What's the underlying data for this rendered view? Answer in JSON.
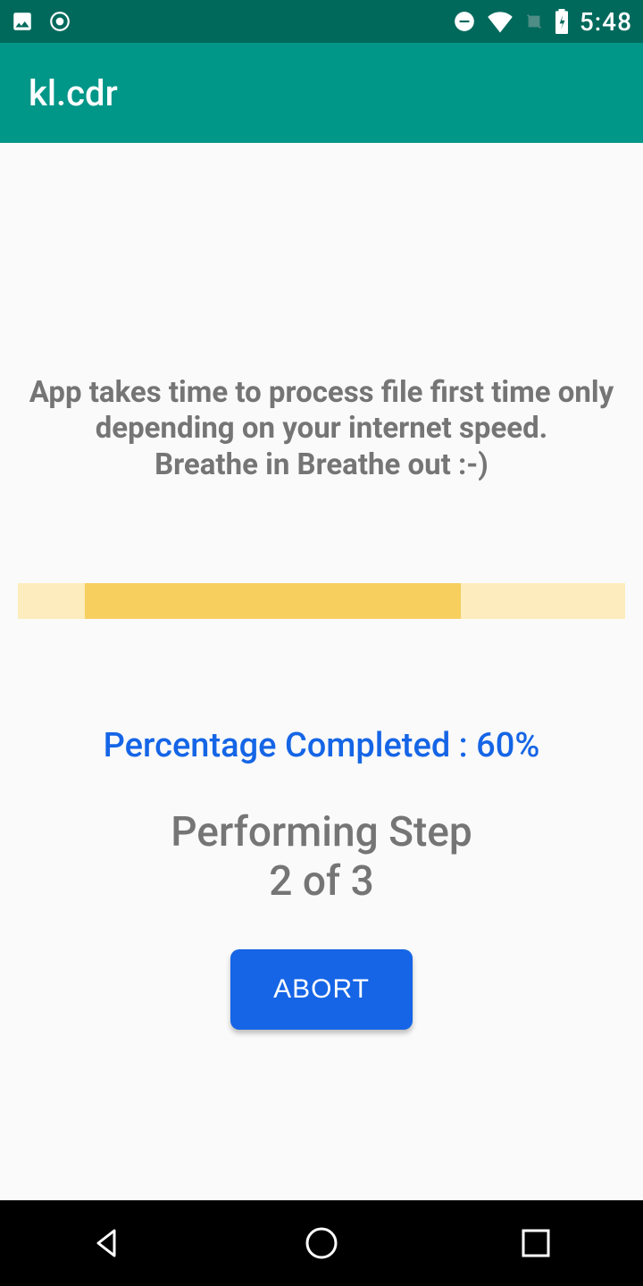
{
  "status_bar": {
    "clock": "5:48"
  },
  "app_bar": {
    "title": "kl.cdr"
  },
  "main": {
    "info_text": "App takes time to process file first time only\ndepending on your internet speed.\nBreathe in Breathe out :-)",
    "progress": {
      "percent": 60,
      "indeterminate_chunk_left_pct": 11,
      "indeterminate_chunk_width_pct": 62
    },
    "percentage_label": "Percentage Completed : 60%",
    "step_text": "Performing Step\n2 of 3",
    "step_current": 2,
    "step_total": 3,
    "abort_label": "ABORT"
  },
  "colors": {
    "status_bar_bg": "#00695c",
    "app_bar_bg": "#009688",
    "accent_blue": "#1565e6",
    "progress_track": "#fdecbd",
    "progress_fill": "#f6cf5e",
    "text_grey": "#757575"
  }
}
